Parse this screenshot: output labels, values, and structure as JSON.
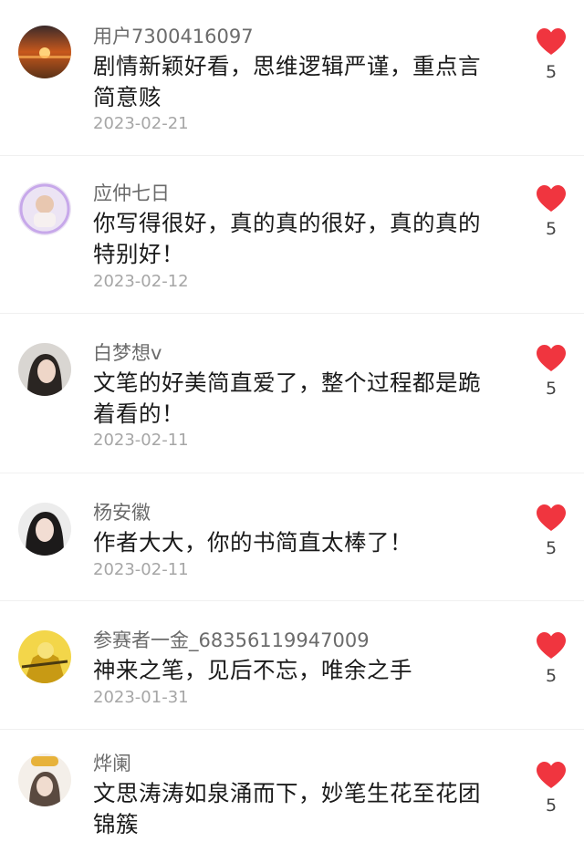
{
  "comments": [
    {
      "username": "用户7300416097",
      "text": "剧情新颖好看，思维逻辑严谨，重点言简意赅",
      "date": "2023-02-21",
      "likes": "5",
      "avatar_icon": "sunset-bunny-avatar"
    },
    {
      "username": "应仲七日",
      "text": "你写得很好，真的真的很好，真的真的特别好！",
      "date": "2023-02-12",
      "likes": "5",
      "avatar_icon": "baby-avatar"
    },
    {
      "username": "白梦想v",
      "text": "文笔的好美简直爱了，整个过程都是跪着看的！",
      "date": "2023-02-11",
      "likes": "5",
      "avatar_icon": "woman-avatar"
    },
    {
      "username": "杨安徽",
      "text": "作者大大，你的书简直太棒了！",
      "date": "2023-02-11",
      "likes": "5",
      "avatar_icon": "girl-avatar"
    },
    {
      "username": "参赛者一金_68356119947009",
      "text": "神来之笔，见后不忘，唯余之手",
      "date": "2023-01-31",
      "likes": "5",
      "avatar_icon": "gold-figure-avatar"
    },
    {
      "username": "烨阑",
      "text": "文思涛涛如泉涌而下，妙笔生花至花团锦簇",
      "date": "",
      "likes": "5",
      "avatar_icon": "badge-girl-avatar"
    }
  ],
  "colors": {
    "heart": "#f0353f",
    "username": "#6b6b6b",
    "date": "#a6a6a6"
  }
}
